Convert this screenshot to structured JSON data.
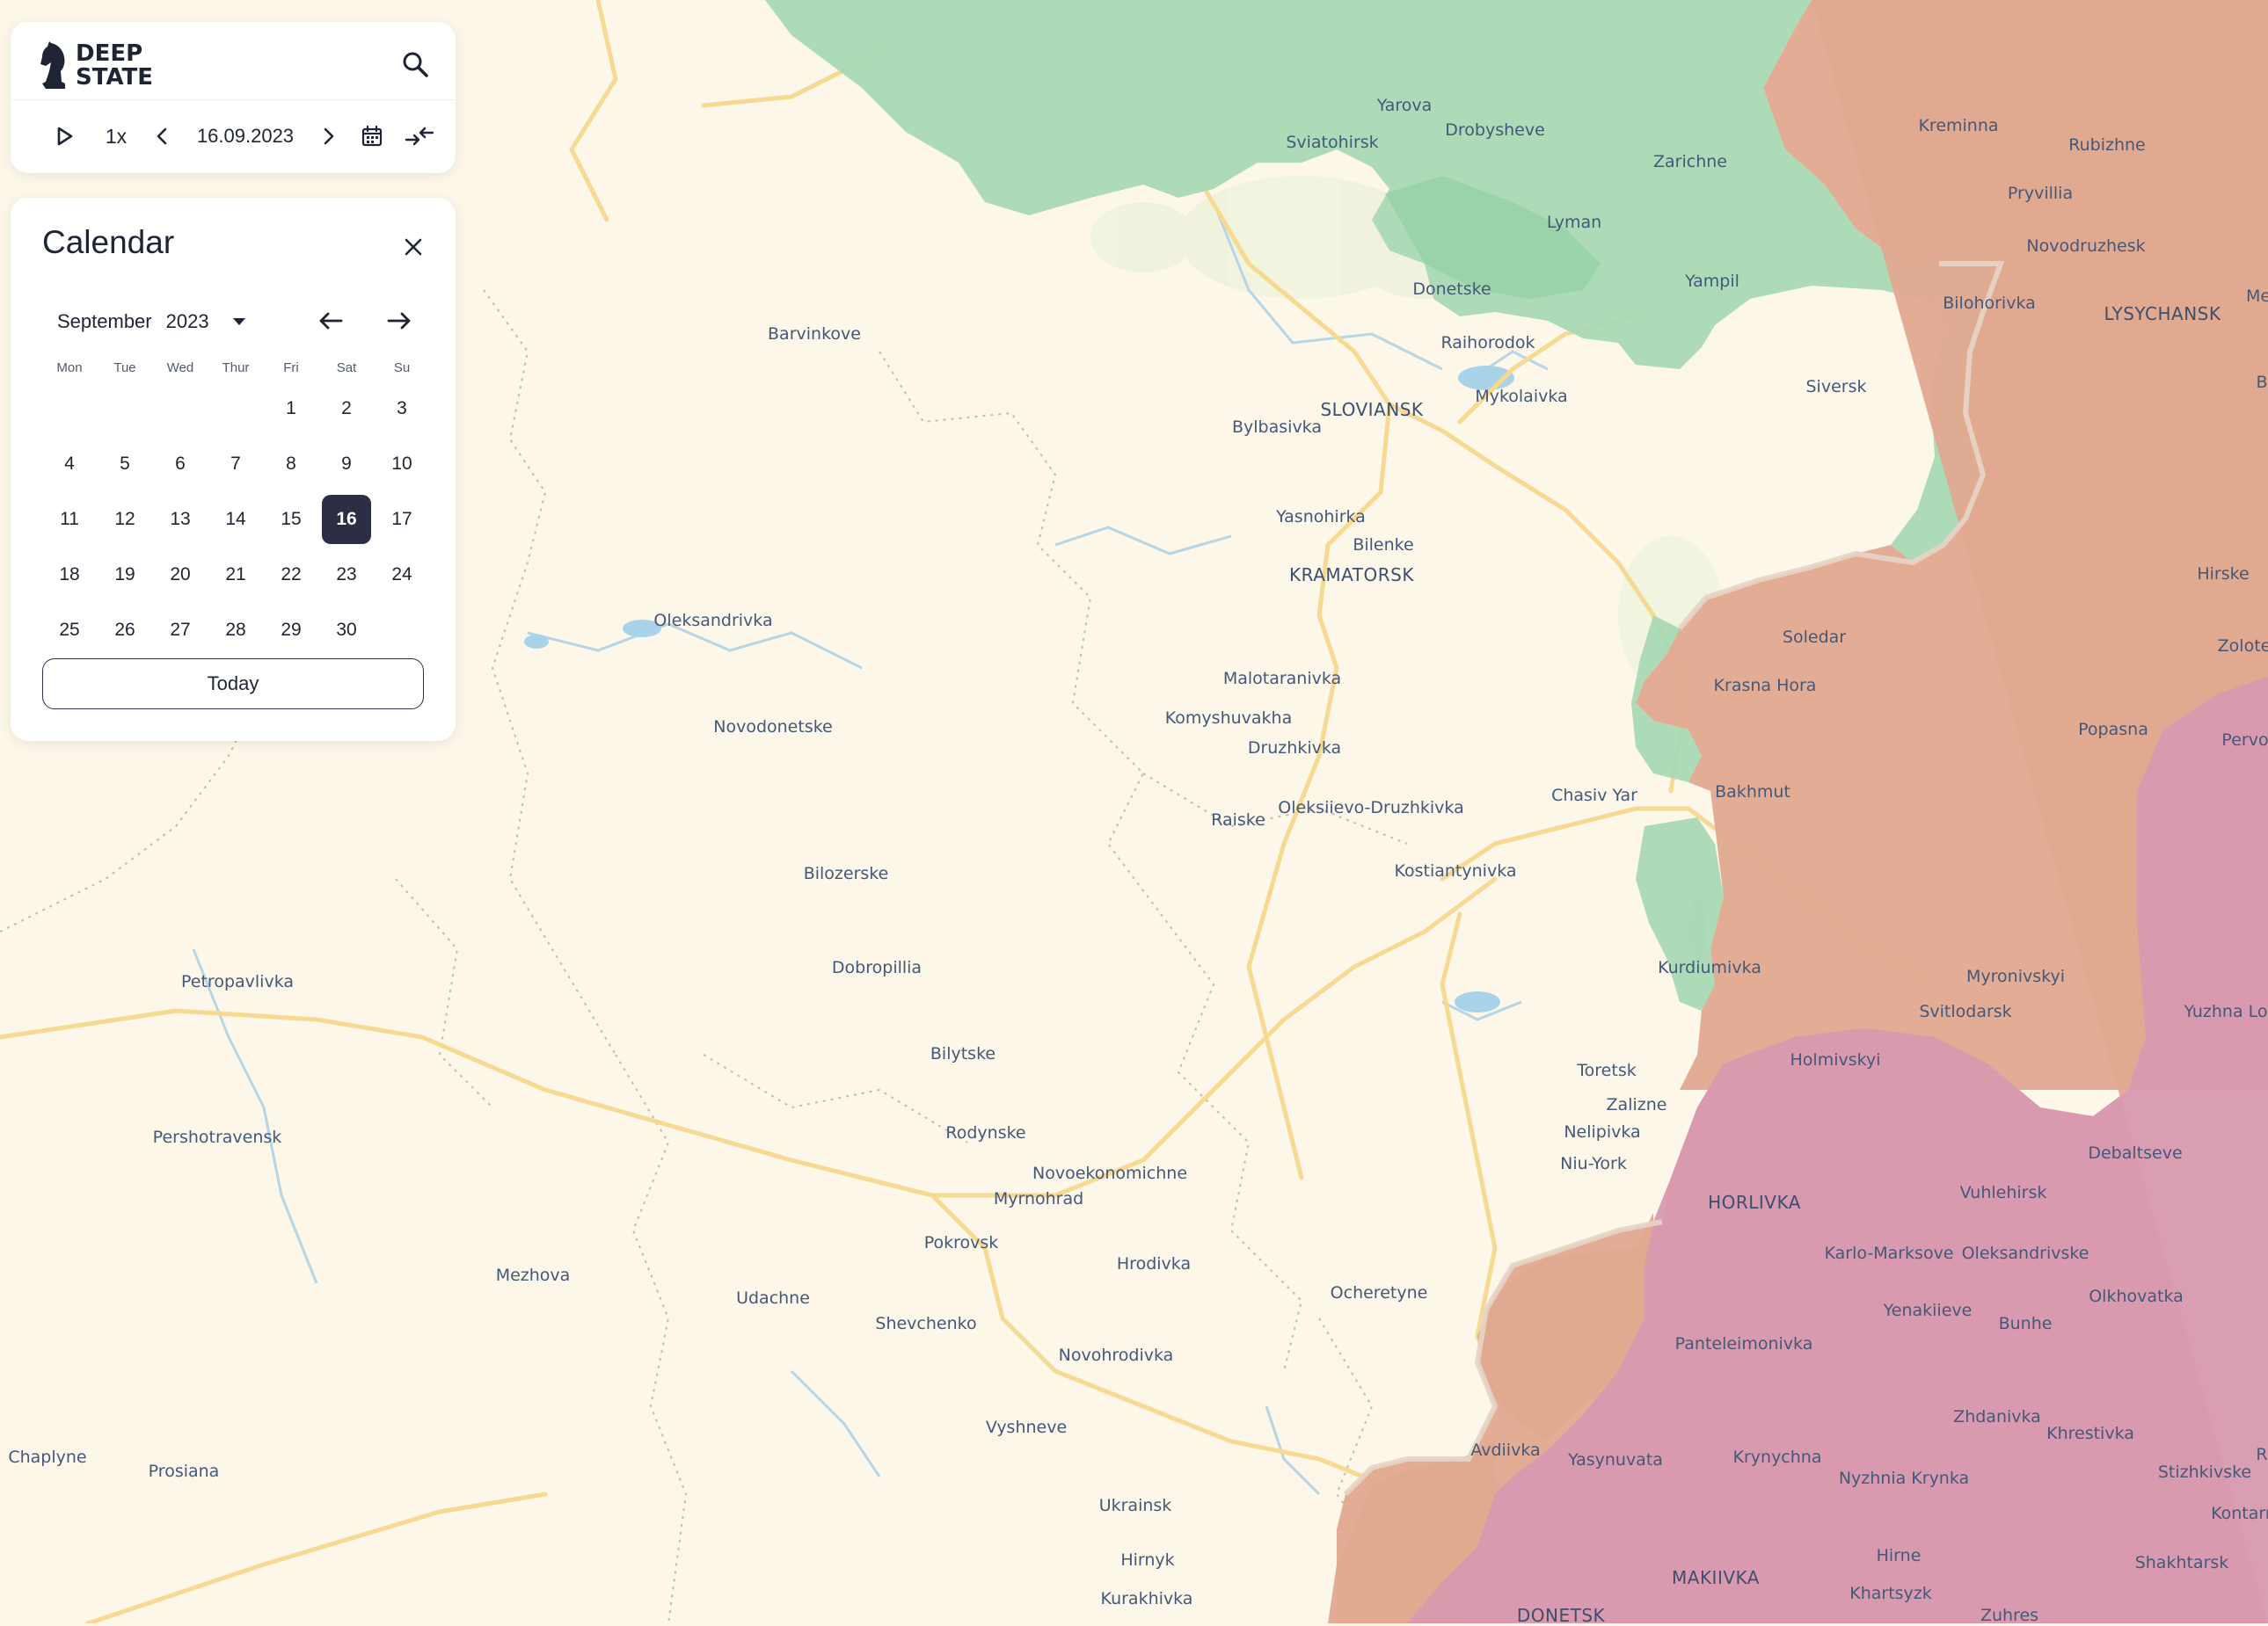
{
  "app": {
    "logo_line1": "DEEP",
    "logo_line2": "STATE"
  },
  "toolbar": {
    "speed": "1x",
    "date": "16.09.2023",
    "icons": [
      "play-icon",
      "chevron-left-icon",
      "chevron-right-icon",
      "calendar-icon",
      "compare-arrows-icon",
      "search-icon"
    ]
  },
  "calendar": {
    "title": "Calendar",
    "month": "September",
    "year": "2023",
    "selected_day": 16,
    "today_label": "Today",
    "weekdays": [
      "Mon",
      "Tue",
      "Wed",
      "Thur",
      "Fri",
      "Sat",
      "Su"
    ],
    "days": [
      [
        "",
        "",
        "",
        "",
        "1",
        "2",
        "3"
      ],
      [
        "4",
        "5",
        "6",
        "7",
        "8",
        "9",
        "10"
      ],
      [
        "11",
        "12",
        "13",
        "14",
        "15",
        "16",
        "17"
      ],
      [
        "18",
        "19",
        "20",
        "21",
        "22",
        "23",
        "24"
      ],
      [
        "25",
        "26",
        "27",
        "28",
        "29",
        "30",
        ""
      ]
    ]
  },
  "map": {
    "colors": {
      "background": "#fdf7ea",
      "liberated": "#a9d9b4",
      "occupied": "#e2a990",
      "occupied_before_2022": "#d899b0",
      "water": "#a8d3e8",
      "roads": "#f7d992"
    },
    "labels": [
      {
        "text": "Yarova",
        "cls": ""
      },
      {
        "text": "Sviatohirsk",
        "cls": ""
      },
      {
        "text": "Drobysheve",
        "cls": ""
      },
      {
        "text": "Zarichne",
        "cls": ""
      },
      {
        "text": "Kreminna",
        "cls": ""
      },
      {
        "text": "Rubizhne",
        "cls": ""
      },
      {
        "text": "Pryvillia",
        "cls": ""
      },
      {
        "text": "Novodruzhesk",
        "cls": ""
      },
      {
        "text": "LYSYCHANSK",
        "cls": "city"
      },
      {
        "text": "Me",
        "cls": ""
      },
      {
        "text": "Lyman",
        "cls": ""
      },
      {
        "text": "Yampil",
        "cls": ""
      },
      {
        "text": "Donetske",
        "cls": ""
      },
      {
        "text": "Bilohorivka",
        "cls": ""
      },
      {
        "text": "Raihorodok",
        "cls": ""
      },
      {
        "text": "Barvinkove",
        "cls": ""
      },
      {
        "text": "Siversk",
        "cls": ""
      },
      {
        "text": "Mykolaivka",
        "cls": ""
      },
      {
        "text": "SLOVIANSK",
        "cls": "city"
      },
      {
        "text": "Bylbasivka",
        "cls": ""
      },
      {
        "text": "Yasnohirka",
        "cls": ""
      },
      {
        "text": "Bilenke",
        "cls": ""
      },
      {
        "text": "KRAMATORSK",
        "cls": "city"
      },
      {
        "text": "Hirske",
        "cls": ""
      },
      {
        "text": "Oleksandrivka",
        "cls": ""
      },
      {
        "text": "Soledar",
        "cls": ""
      },
      {
        "text": "Zolote",
        "cls": ""
      },
      {
        "text": "Malotaranivka",
        "cls": ""
      },
      {
        "text": "Krasna Hora",
        "cls": ""
      },
      {
        "text": "Komyshuvakha",
        "cls": ""
      },
      {
        "text": "Novodonetske",
        "cls": ""
      },
      {
        "text": "Popasna",
        "cls": ""
      },
      {
        "text": "Druzhkivka",
        "cls": ""
      },
      {
        "text": "Pervo",
        "cls": ""
      },
      {
        "text": "Bakhmut",
        "cls": ""
      },
      {
        "text": "Chasiv Yar",
        "cls": ""
      },
      {
        "text": "Oleksiievo-Druzhkivka",
        "cls": ""
      },
      {
        "text": "Raiske",
        "cls": ""
      },
      {
        "text": "Bilozerske",
        "cls": ""
      },
      {
        "text": "Kostiantynivka",
        "cls": ""
      },
      {
        "text": "Dobropillia",
        "cls": ""
      },
      {
        "text": "Kurdiumivka",
        "cls": ""
      },
      {
        "text": "Petropavlivka",
        "cls": ""
      },
      {
        "text": "Myronivskyi",
        "cls": ""
      },
      {
        "text": "Svitlodarsk",
        "cls": ""
      },
      {
        "text": "Yuzhna Lo",
        "cls": ""
      },
      {
        "text": "Bilytske",
        "cls": ""
      },
      {
        "text": "Holmivskyi",
        "cls": ""
      },
      {
        "text": "Toretsk",
        "cls": ""
      },
      {
        "text": "Zalizne",
        "cls": ""
      },
      {
        "text": "Nelipivka",
        "cls": ""
      },
      {
        "text": "Rodynske",
        "cls": ""
      },
      {
        "text": "Pershotravensk",
        "cls": ""
      },
      {
        "text": "Debaltseve",
        "cls": ""
      },
      {
        "text": "Niu-York",
        "cls": ""
      },
      {
        "text": "Novoekonomichne",
        "cls": ""
      },
      {
        "text": "Vuhlehirsk",
        "cls": ""
      },
      {
        "text": "Myrnohrad",
        "cls": ""
      },
      {
        "text": "HORLIVKA",
        "cls": "city"
      },
      {
        "text": "Pokrovsk",
        "cls": ""
      },
      {
        "text": "Karlo-Marksove",
        "cls": ""
      },
      {
        "text": "Oleksandrivske",
        "cls": ""
      },
      {
        "text": "Hrodivka",
        "cls": ""
      },
      {
        "text": "Mezhova",
        "cls": ""
      },
      {
        "text": "Ocheretyne",
        "cls": ""
      },
      {
        "text": "Olkhovatka",
        "cls": ""
      },
      {
        "text": "Udachne",
        "cls": ""
      },
      {
        "text": "Yenakiieve",
        "cls": ""
      },
      {
        "text": "Shevchenko",
        "cls": ""
      },
      {
        "text": "Bunhe",
        "cls": ""
      },
      {
        "text": "Panteleimonivka",
        "cls": ""
      },
      {
        "text": "Novohrodivka",
        "cls": ""
      },
      {
        "text": "Zhdanivka",
        "cls": ""
      },
      {
        "text": "Vyshneve",
        "cls": ""
      },
      {
        "text": "Khrestivka",
        "cls": ""
      },
      {
        "text": "Avdiivka",
        "cls": ""
      },
      {
        "text": "Chaplyne",
        "cls": ""
      },
      {
        "text": "Yasynuvata",
        "cls": ""
      },
      {
        "text": "Krynychna",
        "cls": ""
      },
      {
        "text": "Stizhkivske",
        "cls": ""
      },
      {
        "text": "Prosiana",
        "cls": ""
      },
      {
        "text": "Nyzhnia Krynka",
        "cls": ""
      },
      {
        "text": "Ukrainsk",
        "cls": ""
      },
      {
        "text": "Kontarn",
        "cls": ""
      },
      {
        "text": "Hirnyk",
        "cls": ""
      },
      {
        "text": "Hirne",
        "cls": ""
      },
      {
        "text": "Shakhtarsk",
        "cls": ""
      },
      {
        "text": "MAKIIVKA",
        "cls": "city"
      },
      {
        "text": "Khartsyzk",
        "cls": ""
      },
      {
        "text": "Kurakhivka",
        "cls": ""
      },
      {
        "text": "DONETSK",
        "cls": "city"
      },
      {
        "text": "Zuhres",
        "cls": ""
      },
      {
        "text": "B",
        "cls": ""
      },
      {
        "text": "R",
        "cls": ""
      }
    ]
  }
}
